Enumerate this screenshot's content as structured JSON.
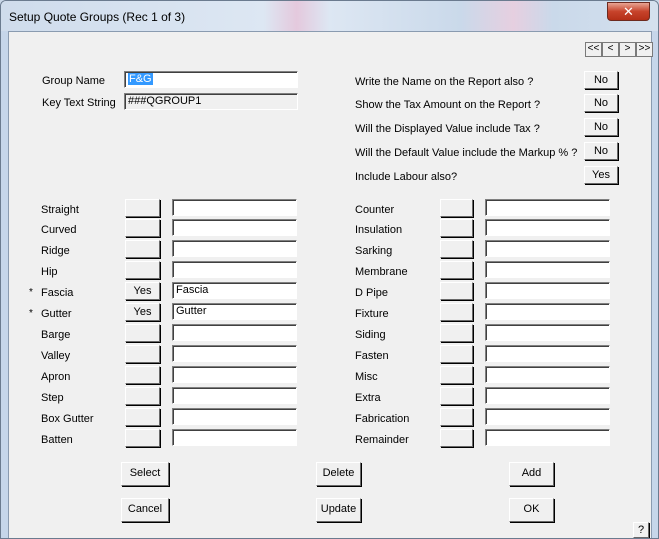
{
  "window": {
    "title": "Setup Quote Groups (Rec 1 of 3)",
    "close_glyph": "✕"
  },
  "nav": [
    "<<",
    "<",
    ">",
    ">>"
  ],
  "group_name": {
    "label": "Group Name",
    "value": "F&G"
  },
  "key_text": {
    "label": "Key Text String",
    "value": "###QGROUP1"
  },
  "options": [
    {
      "label": "Write the Name on the Report also ?",
      "value": "No"
    },
    {
      "label": "Show the Tax Amount on the Report ?",
      "value": "No"
    },
    {
      "label": "Will the Displayed Value include Tax ?",
      "value": "No"
    },
    {
      "label": "Will the Default Value include the Markup % ?",
      "value": "No"
    },
    {
      "label": "Include Labour also?",
      "value": "Yes"
    }
  ],
  "left_items": [
    {
      "label": "Straight",
      "star": "",
      "toggle": "",
      "value": ""
    },
    {
      "label": "Curved",
      "star": "",
      "toggle": "",
      "value": ""
    },
    {
      "label": "Ridge",
      "star": "",
      "toggle": "",
      "value": ""
    },
    {
      "label": "Hip",
      "star": "",
      "toggle": "",
      "value": ""
    },
    {
      "label": "Fascia",
      "star": "*",
      "toggle": "Yes",
      "value": "Fascia"
    },
    {
      "label": "Gutter",
      "star": "*",
      "toggle": "Yes",
      "value": "Gutter"
    },
    {
      "label": "Barge",
      "star": "",
      "toggle": "",
      "value": ""
    },
    {
      "label": "Valley",
      "star": "",
      "toggle": "",
      "value": ""
    },
    {
      "label": "Apron",
      "star": "",
      "toggle": "",
      "value": ""
    },
    {
      "label": "Step",
      "star": "",
      "toggle": "",
      "value": ""
    },
    {
      "label": "Box Gutter",
      "star": "",
      "toggle": "",
      "value": ""
    },
    {
      "label": "Batten",
      "star": "",
      "toggle": "",
      "value": ""
    }
  ],
  "right_items": [
    {
      "label": "Counter",
      "toggle": "",
      "value": ""
    },
    {
      "label": "Insulation",
      "toggle": "",
      "value": ""
    },
    {
      "label": "Sarking",
      "toggle": "",
      "value": ""
    },
    {
      "label": "Membrane",
      "toggle": "",
      "value": ""
    },
    {
      "label": "D Pipe",
      "toggle": "",
      "value": ""
    },
    {
      "label": "Fixture",
      "toggle": "",
      "value": ""
    },
    {
      "label": "Siding",
      "toggle": "",
      "value": ""
    },
    {
      "label": "Fasten",
      "toggle": "",
      "value": ""
    },
    {
      "label": "Misc",
      "toggle": "",
      "value": ""
    },
    {
      "label": "Extra",
      "toggle": "",
      "value": ""
    },
    {
      "label": "Fabrication",
      "toggle": "",
      "value": ""
    },
    {
      "label": "Remainder",
      "toggle": "",
      "value": ""
    }
  ],
  "buttons": {
    "select": "Select",
    "cancel": "Cancel",
    "delete": "Delete",
    "update": "Update",
    "add": "Add",
    "ok": "OK",
    "help": "?"
  }
}
